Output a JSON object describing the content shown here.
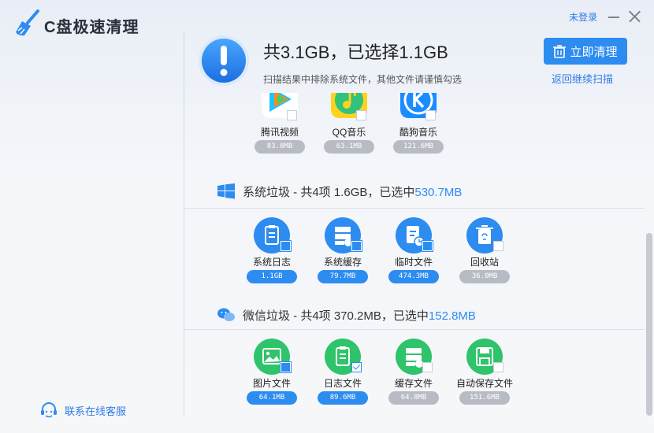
{
  "app": {
    "title": "C盘极速清理"
  },
  "header": {
    "login": "未登录",
    "summary": "共3.1GB，已选择1.1GB",
    "subtitle": "扫描结果中排除系统文件，其他文件请谨慎勾选",
    "clean_button": "立即清理",
    "rescan": "返回继续扫描"
  },
  "sidebar": {
    "support": "联系在线客服"
  },
  "sections": {
    "media": {
      "items": [
        {
          "label": "腾讯视频",
          "size": "83.8MB",
          "selected": false
        },
        {
          "label": "QQ音乐",
          "size": "63.1MB",
          "selected": false
        },
        {
          "label": "酷狗音乐",
          "size": "121.6MB",
          "selected": false
        }
      ]
    },
    "system": {
      "title_prefix": "系统垃圾 - 共4项 1.6GB，已选中",
      "title_selected": "530.7MB",
      "items": [
        {
          "label": "系统日志",
          "size": "1.1GB",
          "selected": true
        },
        {
          "label": "系统缓存",
          "size": "79.7MB",
          "selected": true
        },
        {
          "label": "临时文件",
          "size": "474.3MB",
          "selected": true
        },
        {
          "label": "回收站",
          "size": "36.0MB",
          "selected": false
        }
      ]
    },
    "wechat": {
      "title_prefix": "微信垃圾 - 共4项 370.2MB，已选中",
      "title_selected": "152.8MB",
      "items": [
        {
          "label": "图片文件",
          "size": "64.1MB",
          "selected": true
        },
        {
          "label": "日志文件",
          "size": "89.6MB",
          "selected": true
        },
        {
          "label": "缓存文件",
          "size": "64.8MB",
          "selected": false
        },
        {
          "label": "自动保存文件",
          "size": "151.6MB",
          "selected": false
        }
      ]
    }
  },
  "colors": {
    "accent": "#2d8cf0",
    "wechat_green": "#2fc46b",
    "unselected": "#b7bcc4"
  }
}
